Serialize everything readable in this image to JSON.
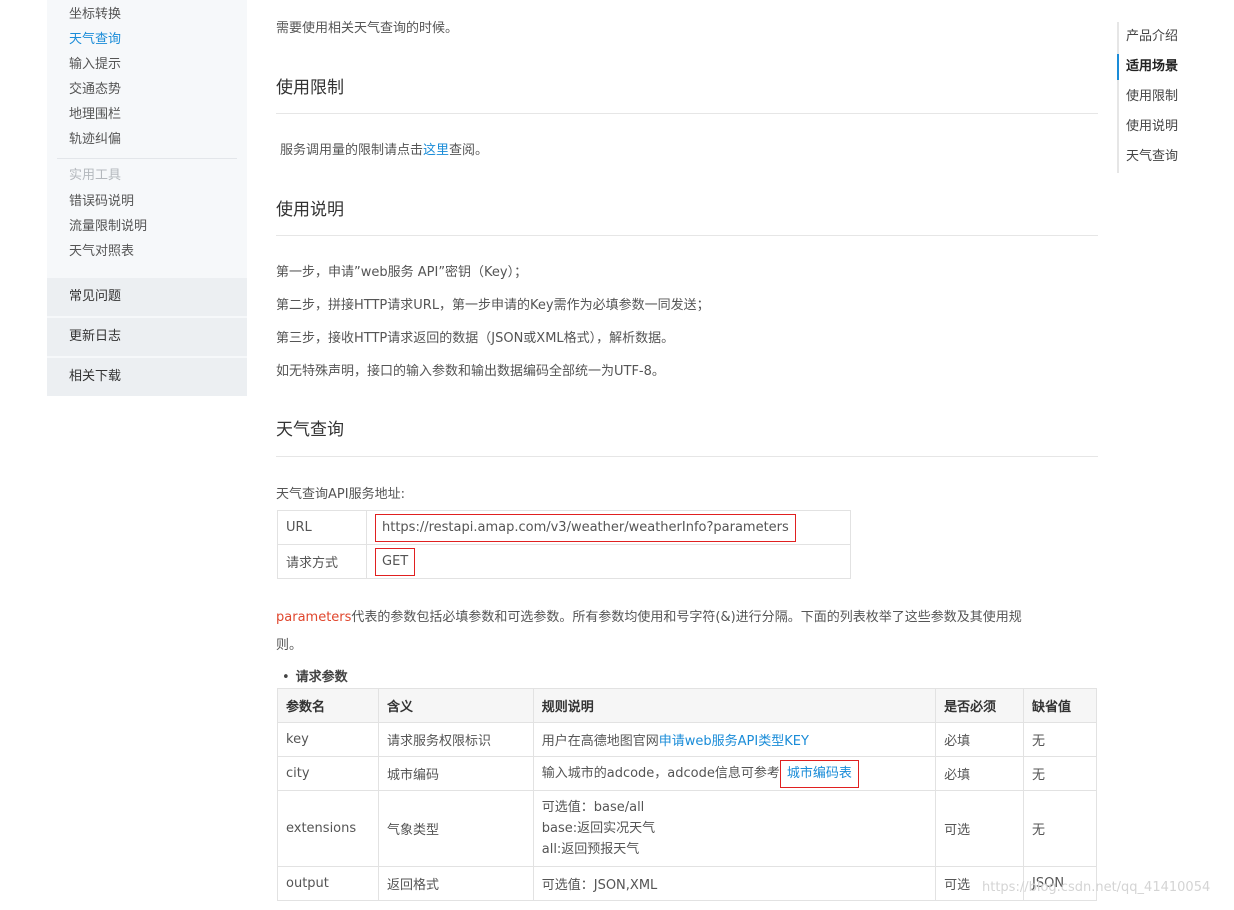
{
  "sidebar": {
    "links": [
      {
        "label": "坐标转换",
        "active": false
      },
      {
        "label": "天气查询",
        "active": true
      },
      {
        "label": "输入提示",
        "active": false
      },
      {
        "label": "交通态势",
        "active": false
      },
      {
        "label": "地理围栏",
        "active": false
      },
      {
        "label": "轨迹纠偏",
        "active": false
      }
    ],
    "tools_title": "实用工具",
    "tools": [
      "错误码说明",
      "流量限制说明",
      "天气对照表"
    ],
    "sections": [
      "常见问题",
      "更新日志",
      "相关下载"
    ]
  },
  "main": {
    "intro_text": "需要使用相关天气查询的时候。",
    "limits": {
      "heading": "使用限制",
      "text_before": "服务调用量的限制请点击",
      "link": "这里",
      "text_after": "查阅。"
    },
    "usage": {
      "heading": "使用说明",
      "steps": [
        "第一步，申请”web服务 API”密钥（Key）；",
        "第二步，拼接HTTP请求URL，第一步申请的Key需作为必填参数一同发送；",
        "第三步，接收HTTP请求返回的数据（JSON或XML格式），解析数据。",
        "如无特殊声明，接口的输入参数和输出数据编码全部统一为UTF-8。"
      ]
    },
    "weather": {
      "heading": "天气查询",
      "service_address_label": "天气查询API服务地址:",
      "url_table": {
        "url_key": "URL",
        "url_value": "https://restapi.amap.com/v3/weather/weatherInfo?parameters",
        "method_key": "请求方式",
        "method_value": "GET"
      },
      "parameters_word": "parameters",
      "parameters_desc_line1": "代表的参数包括必填参数和可选参数。所有参数均使用和号字符(&)进行分隔。下面的列表枚举了这些参数及其使用规",
      "parameters_desc_line2": "则。",
      "request_params_title": "请求参数",
      "table": {
        "headers": [
          "参数名",
          "含义",
          "规则说明",
          "是否必须",
          "缺省值"
        ],
        "rows": [
          {
            "name": "key",
            "meaning": "请求服务权限标识",
            "rule_text": "用户在高德地图官网",
            "rule_link": "申请web服务API类型KEY",
            "required": "必填",
            "default": "无"
          },
          {
            "name": "city",
            "meaning": "城市编码",
            "rule_text": "输入城市的adcode，adcode信息可参考",
            "rule_link": "城市编码表",
            "required": "必填",
            "default": "无"
          },
          {
            "name": "extensions",
            "meaning": "气象类型",
            "rule_lines": [
              "可选值：base/all",
              "base:返回实况天气",
              "all:返回预报天气"
            ],
            "required": "可选",
            "default": "无"
          },
          {
            "name": "output",
            "meaning": "返回格式",
            "rule_text": "可选值：JSON,XML",
            "required": "可选",
            "default": "JSON"
          }
        ]
      }
    }
  },
  "toc": {
    "items": [
      {
        "label": "产品介绍",
        "active": false
      },
      {
        "label": "适用场景",
        "active": true
      },
      {
        "label": "使用限制",
        "active": false
      },
      {
        "label": "使用说明",
        "active": false
      },
      {
        "label": "天气查询",
        "active": false
      }
    ]
  },
  "watermark": "https://blog.csdn.net/qq_41410054"
}
